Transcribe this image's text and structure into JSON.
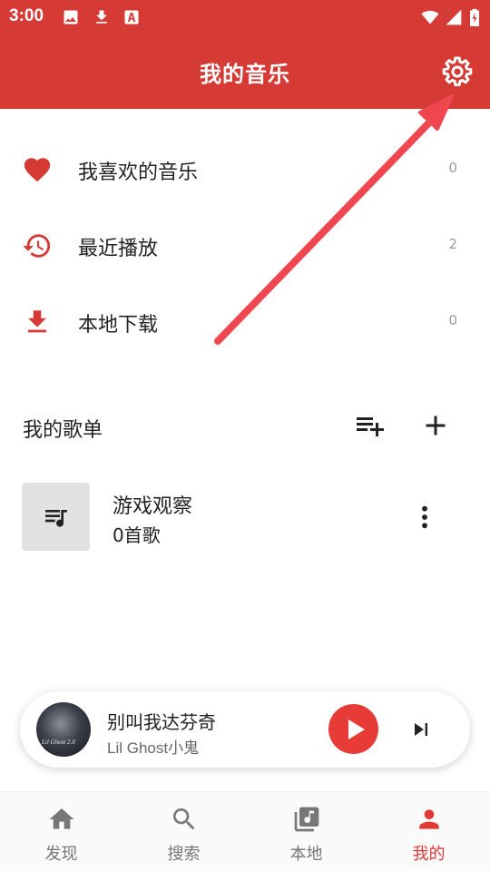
{
  "status_bar": {
    "time": "3:00",
    "icons": [
      "image-icon",
      "download-icon",
      "text-icon",
      "wifi-icon",
      "signal-icon",
      "battery-charging-icon"
    ]
  },
  "app_bar": {
    "title": "我的音乐",
    "settings_icon": "gear-icon"
  },
  "library": [
    {
      "label": "我喜欢的音乐",
      "count": "0",
      "icon": "heart-icon"
    },
    {
      "label": "最近播放",
      "count": "2",
      "icon": "history-icon"
    },
    {
      "label": "本地下载",
      "count": "0",
      "icon": "download-icon"
    }
  ],
  "playlists_section": {
    "title": "我的歌单",
    "actions": [
      "playlist-add-icon",
      "plus-icon"
    ]
  },
  "playlists": [
    {
      "name": "游戏观察",
      "subtitle": "0首歌",
      "icon": "queue-music-icon"
    }
  ],
  "mini_player": {
    "song": "别叫我达芬奇",
    "artist": "Lil Ghost小鬼",
    "cover_text": "Lil Ghost 2.0"
  },
  "tabs": [
    {
      "label": "发现",
      "icon": "home-icon"
    },
    {
      "label": "搜索",
      "icon": "search-icon"
    },
    {
      "label": "本地",
      "icon": "music-library-icon"
    },
    {
      "label": "我的",
      "icon": "person-icon",
      "active": true
    }
  ],
  "colors": {
    "primary": "#d63a35",
    "accent": "#e63b37",
    "annotation_arrow": "#f0464f",
    "muted_text": "#9a9a9a",
    "cover_bg": "#e2e2e2"
  }
}
